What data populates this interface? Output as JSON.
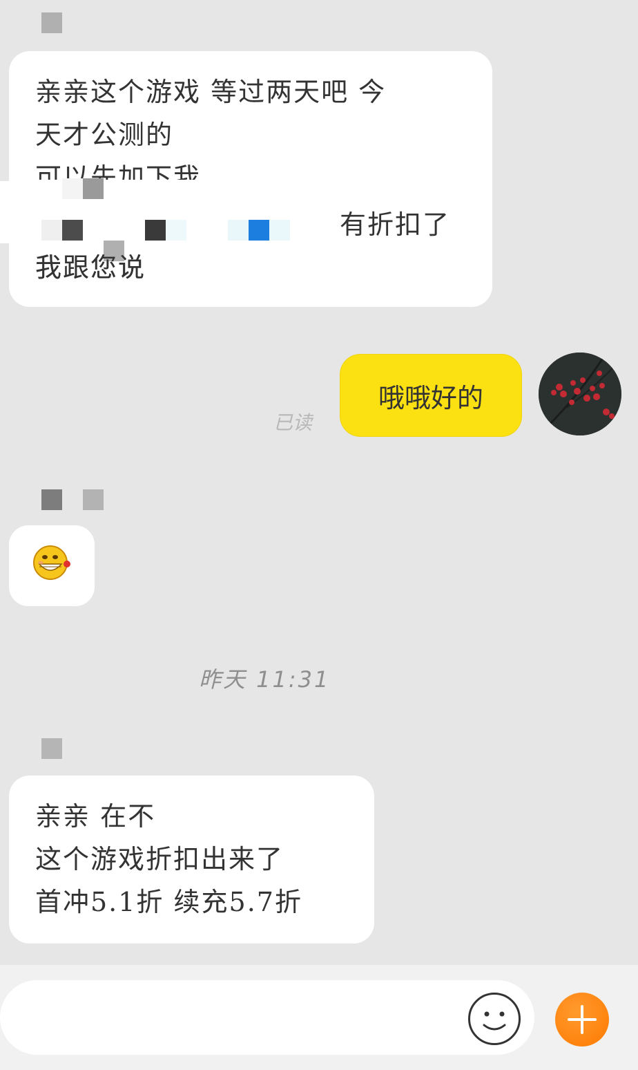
{
  "messages": [
    {
      "id": "incoming-1",
      "lines": [
        "亲亲这个游戏 等过两天吧 今",
        "天才公测的",
        "可以先加下我",
        "有折扣了",
        "我跟您说"
      ]
    },
    {
      "id": "outgoing-1",
      "text": "哦哦好的",
      "status": "已读"
    },
    {
      "id": "incoming-2",
      "sticker": "grinning-rose-emoji"
    },
    {
      "id": "incoming-3",
      "lines": [
        "亲亲 在不",
        "这个游戏折扣出来了",
        "首冲5.1折 续充5.7折"
      ]
    }
  ],
  "timestamp": "昨天 11:31",
  "composer": {
    "placeholder": "",
    "emoji_icon": "smiley-icon",
    "plus_icon": "plus-icon"
  },
  "colors": {
    "background": "#e6e6e6",
    "outgoing_bubble": "#fbe012",
    "incoming_bubble": "#ffffff",
    "plus_button": "#ff7a00"
  }
}
